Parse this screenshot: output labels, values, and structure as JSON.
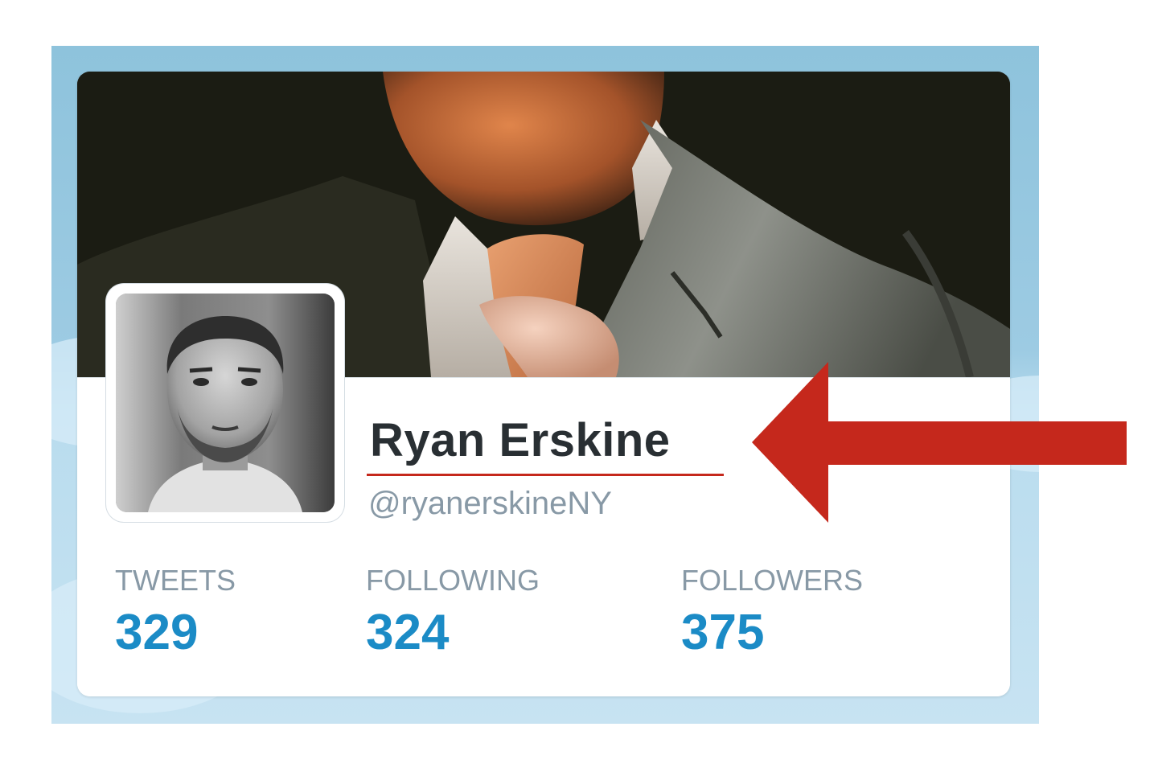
{
  "profile": {
    "name": "Ryan Erskine",
    "handle": "@ryanerskineNY"
  },
  "stats": [
    {
      "label": "TWEETS",
      "value": "329"
    },
    {
      "label": "FOLLOWING",
      "value": "324"
    },
    {
      "label": "FOLLOWERS",
      "value": "375"
    }
  ],
  "colors": {
    "name": "#292f33",
    "muted": "#8899a6",
    "stat_value": "#1b8bc6",
    "annotation": "#c5281c",
    "frame": "#8ec3dc"
  },
  "annotation": {
    "arrow": "arrow-left-icon",
    "underline_target": "profile-name"
  }
}
